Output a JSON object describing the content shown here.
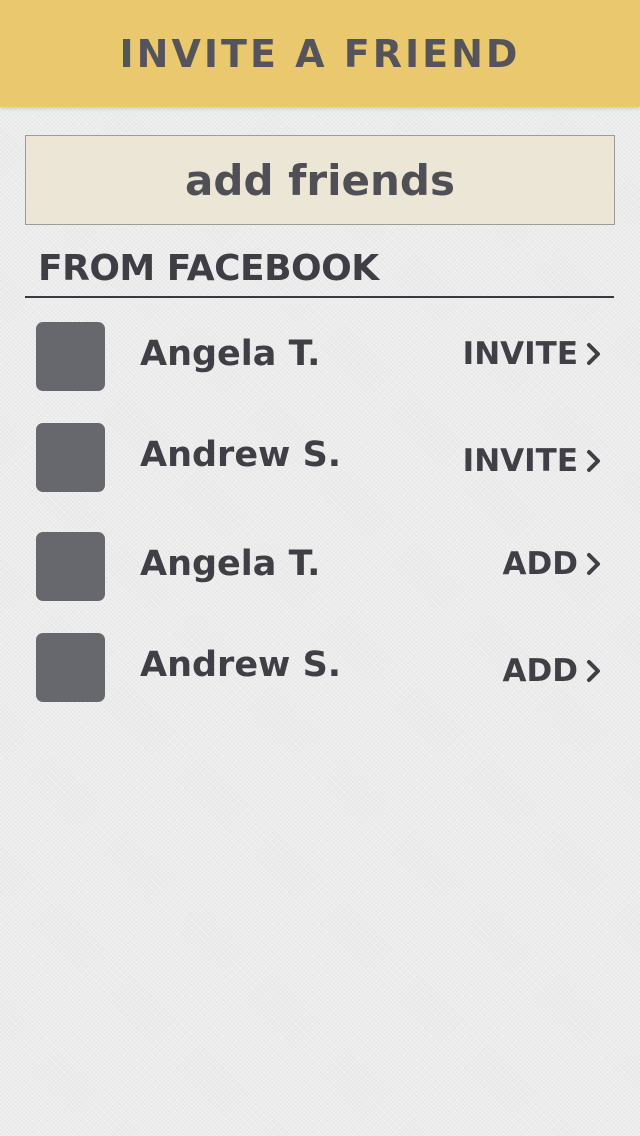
{
  "header": {
    "title": "INVITE A FRIEND"
  },
  "add_button": {
    "label": "add friends"
  },
  "section": {
    "title": "FROM FACEBOOK"
  },
  "friends": [
    {
      "name": "Angela T.",
      "action": "INVITE"
    },
    {
      "name": "Andrew S.",
      "action": "INVITE"
    },
    {
      "name": "Angela T.",
      "action": "ADD"
    },
    {
      "name": "Andrew S.",
      "action": "ADD"
    }
  ],
  "colors": {
    "header_bg": "#eac86e",
    "button_bg": "#ece6d6",
    "avatar": "#67676e",
    "text": "#3f3f45"
  },
  "icons": {
    "action_chevron": "chevron-right-icon"
  }
}
